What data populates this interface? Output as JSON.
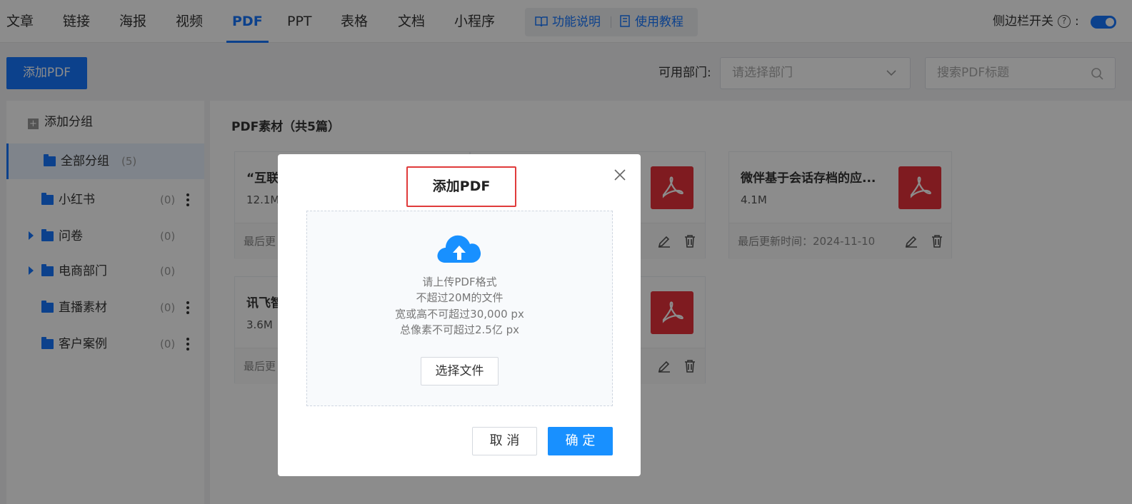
{
  "nav": {
    "tabs": [
      "文章",
      "链接",
      "海报",
      "视频",
      "PDF",
      "PPT",
      "表格",
      "文档",
      "小程序"
    ],
    "active_tab": "PDF",
    "help_items": [
      "功能说明",
      "使用教程"
    ],
    "sidebar_toggle_label": "侧边栏开关",
    "sidebar_toggle_on": true
  },
  "toolbar": {
    "add_button": "添加PDF",
    "dept_label": "可用部门:",
    "dept_placeholder": "请选择部门",
    "search_placeholder": "搜索PDF标题"
  },
  "sidebar": {
    "add_group": "添加分组",
    "groups": [
      {
        "name": "全部分组",
        "count": "(5)",
        "active": true
      },
      {
        "name": "小红书",
        "count": "(0)"
      },
      {
        "name": "问卷",
        "count": "(0)",
        "expandable": true
      },
      {
        "name": "电商部门",
        "count": "(0)",
        "expandable": true
      },
      {
        "name": "直播素材",
        "count": "(0)"
      },
      {
        "name": "客户案例",
        "count": "(0)"
      }
    ]
  },
  "content": {
    "title": "PDF素材（共5篇）",
    "cards": [
      {
        "title": "“互联",
        "size": "12.1M",
        "date": "最后更"
      },
      {
        "title": "",
        "size": "",
        "date": ""
      },
      {
        "title": "微伴基于会话存档的应...",
        "size": "4.1M",
        "date": "最后更新时间：2024-11-10"
      },
      {
        "title": "讯飞智",
        "size": "3.6M",
        "date": "最后更"
      },
      {
        "title": "",
        "size": "",
        "date": ""
      }
    ]
  },
  "modal": {
    "title": "添加PDF",
    "upload_lines": [
      "请上传PDF格式",
      "不超过20M的文件",
      "宽或高不可超过30,000 px",
      "总像素不可超过2.5亿 px"
    ],
    "choose_file": "选择文件",
    "cancel": "取 消",
    "ok": "确 定"
  },
  "colors": {
    "accent": "#1677ff",
    "pdf_red": "#e8323b",
    "highlight_border": "#e03b3b"
  }
}
